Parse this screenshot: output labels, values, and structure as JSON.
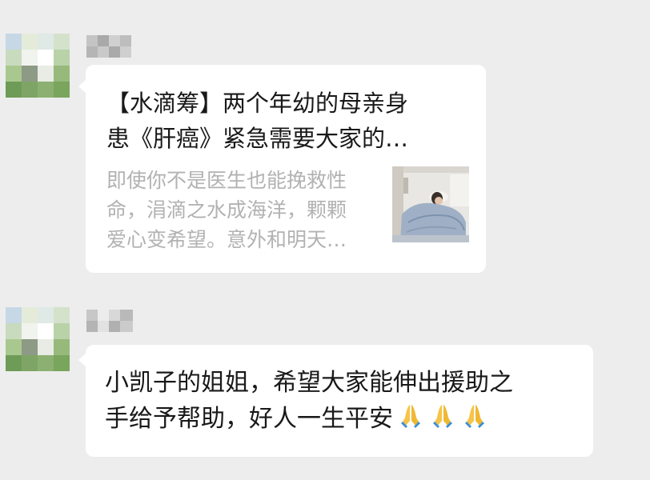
{
  "messages": [
    {
      "type": "link-card",
      "sender_avatar_icon": "blurred-avatar-icon",
      "title_lines": [
        "【水滴筹】两个年幼的母亲身",
        "患《肝癌》紧急需要大家的…"
      ],
      "description_lines": [
        "即使你不是医生也能挽救性",
        "命，涓滴之水成海洋，颗颗",
        "爱心变希望。意外和明天…"
      ],
      "thumbnail_icon": "patient-in-hospital-bed-image"
    },
    {
      "type": "text",
      "sender_avatar_icon": "blurred-avatar-icon",
      "text_lines": [
        "小凯子的姐姐，希望大家能伸出援助之",
        "手给予帮助，好人一生平安"
      ],
      "emoji": [
        "folded-hands-icon",
        "folded-hands-icon",
        "folded-hands-icon"
      ]
    }
  ],
  "colors": {
    "background": "#ededed",
    "bubble": "#ffffff",
    "text": "#191919",
    "description": "#b2b2b2"
  }
}
